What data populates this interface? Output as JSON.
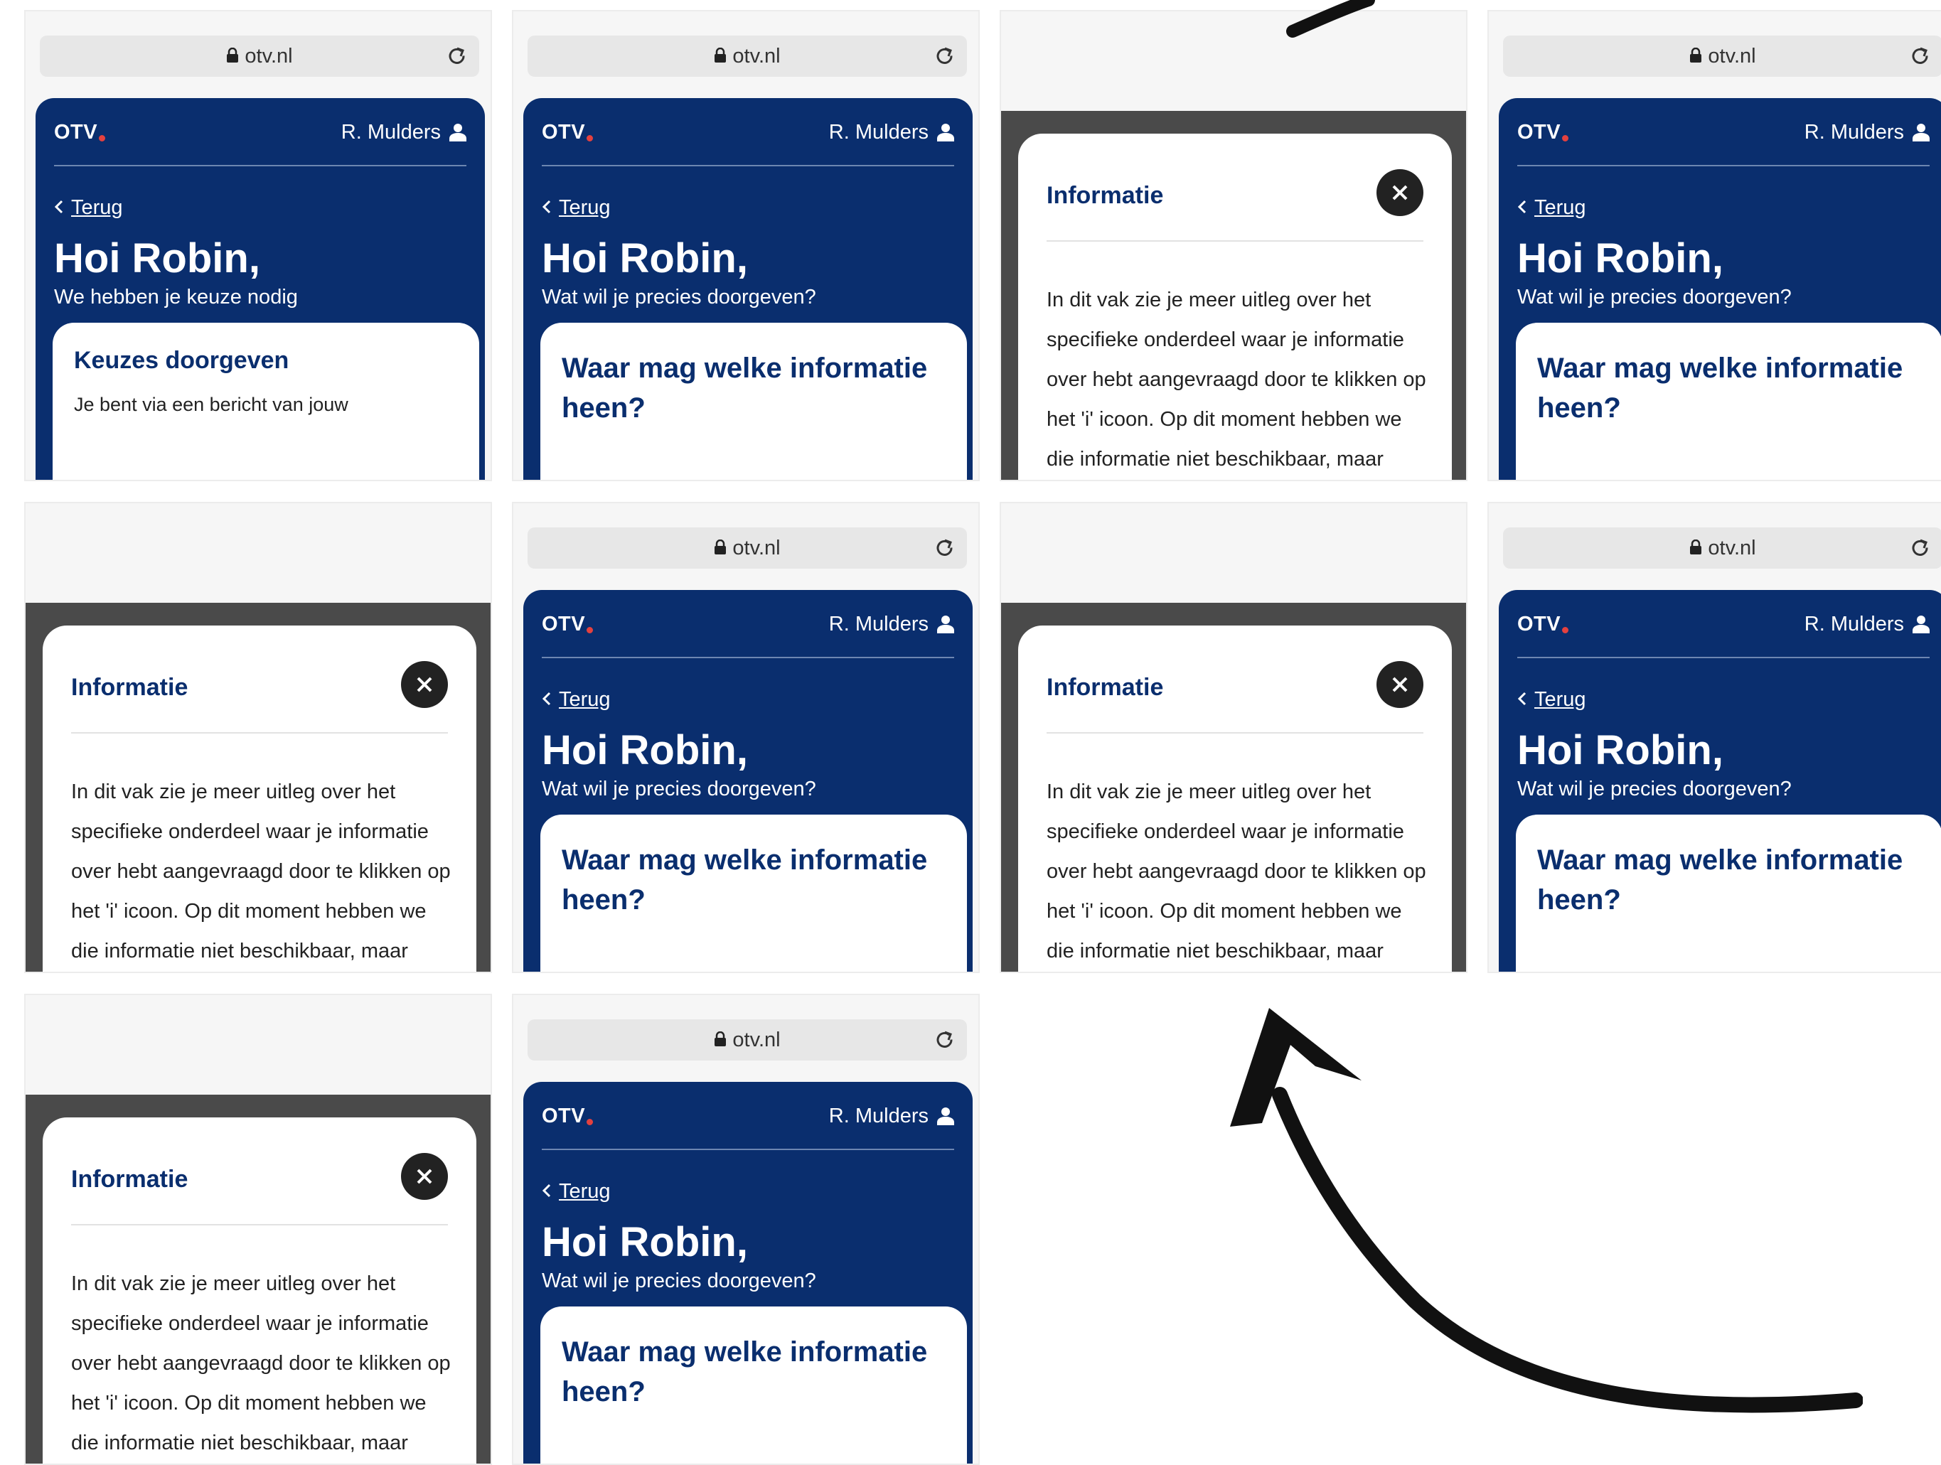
{
  "browser": {
    "url": "otv.nl"
  },
  "app": {
    "logo": "OTV",
    "user_name": "R. Mulders",
    "back_label": "Terug",
    "greeting": "Hoi Robin,"
  },
  "screens": {
    "choice": {
      "subtitle": "We hebben je keuze nodig",
      "card_title": "Keuzes doorgeven",
      "card_body": "Je bent via een bericht van jouw"
    },
    "question": {
      "subtitle": "Wat wil je precies doorgeven?",
      "card_title": "Waar mag welke informatie",
      "card_title_2": "heen?"
    },
    "modal": {
      "title": "Informatie",
      "lines": [
        "In dit vak zie je meer uitleg over het",
        "specifieke onderdeel waar je informatie",
        "over hebt aangevraagd door te klikken op",
        "het 'i' icoon. Op dit moment hebben we",
        "die informatie niet beschikbaar, maar"
      ]
    }
  },
  "colors": {
    "brand": "#0a2e6e",
    "accent": "#e4413f",
    "overlay": "#4a4a4a"
  },
  "icons": [
    "lock-icon",
    "reload-icon",
    "user-icon",
    "chevron-left-icon",
    "close-icon",
    "arrow-icon"
  ]
}
